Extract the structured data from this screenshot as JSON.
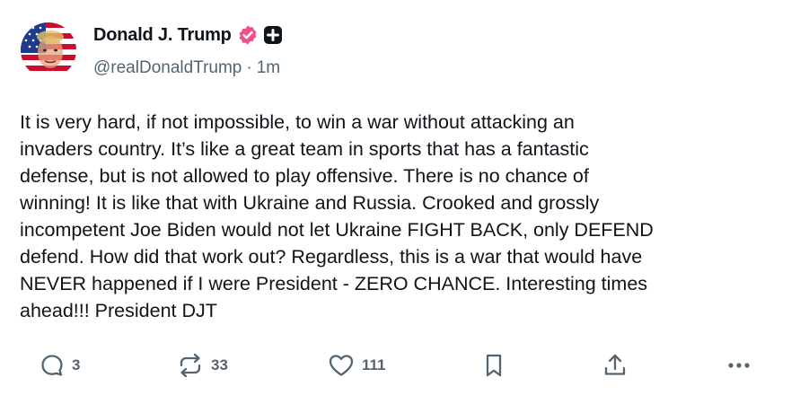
{
  "author": {
    "display_name": "Donald J. Trump",
    "handle": "@realDonaldTrump",
    "separator": "·",
    "time_ago": "1m",
    "verified_color": "#f0518d"
  },
  "post": {
    "text": "It is very hard, if not impossible, to win a war without attacking an\ninvaders country. It’s like a great team in sports that has a fantastic\ndefense, but is not allowed to play offensive. There is no chance of\nwinning! It is like that with Ukraine and Russia. Crooked and grossly\nincompetent Joe Biden would not let Ukraine FIGHT BACK, only DEFEND\ndefend. How did that work out? Regardless, this is a war that would have\nNEVER happened if I were President - ZERO CHANCE. Interesting times\nahead!!! President DJT"
  },
  "actions": {
    "reply_count": "3",
    "retruth_count": "33",
    "like_count": "111",
    "icon_color": "#536471"
  }
}
